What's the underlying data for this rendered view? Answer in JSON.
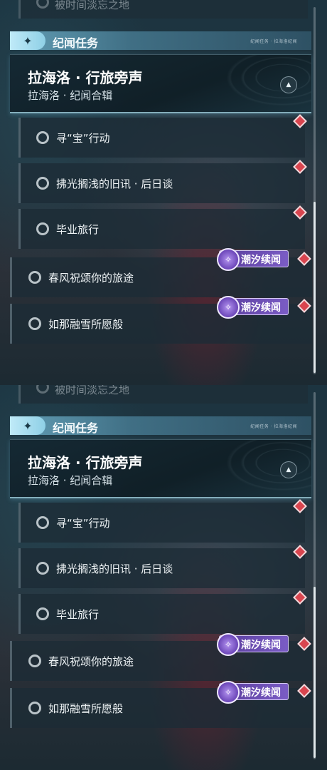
{
  "panels": [
    {
      "prev_item_label": "被时间淡忘之地",
      "section": {
        "title": "纪闻任务",
        "tiny_text": "纪闻任务 · 拉海洛纪闻"
      },
      "header": {
        "title": "拉海洛 · 行旅旁声",
        "subtitle": "拉海洛 · 纪闻合辑",
        "collapse_icon": "▲"
      },
      "sub_items": [
        "寻“宝”行动",
        "拂光搁浅的旧讯 · 后日谈",
        "毕业旅行"
      ],
      "main_items": [
        "春风祝颂你的旅途",
        "如那融雪所愿般"
      ],
      "badge_label": "潮汐续闻"
    },
    {
      "prev_item_label": "被时间淡忘之地",
      "section": {
        "title": "纪闻任务",
        "tiny_text": "纪闻任务 · 拉海洛纪闻"
      },
      "header": {
        "title": "拉海洛 · 行旅旁声",
        "subtitle": "拉海洛 · 纪闻合辑",
        "collapse_icon": "▲"
      },
      "sub_items": [
        "寻“宝”行动",
        "拂光搁浅的旧讯 · 后日谈",
        "毕业旅行"
      ],
      "main_items": [
        "春风祝颂你的旅途",
        "如那融雪所愿般"
      ],
      "badge_label": "潮汐续闻"
    }
  ],
  "colors": {
    "accent": "#8fd0e6",
    "diamond": "#d9454f",
    "badge": "#6b45b8"
  },
  "icons": {
    "section": "star-icon",
    "collapse": "chevron-up-icon",
    "status": "ring-icon",
    "badge": "tidal-emblem-icon",
    "tracked": "diamond-marker-icon"
  }
}
